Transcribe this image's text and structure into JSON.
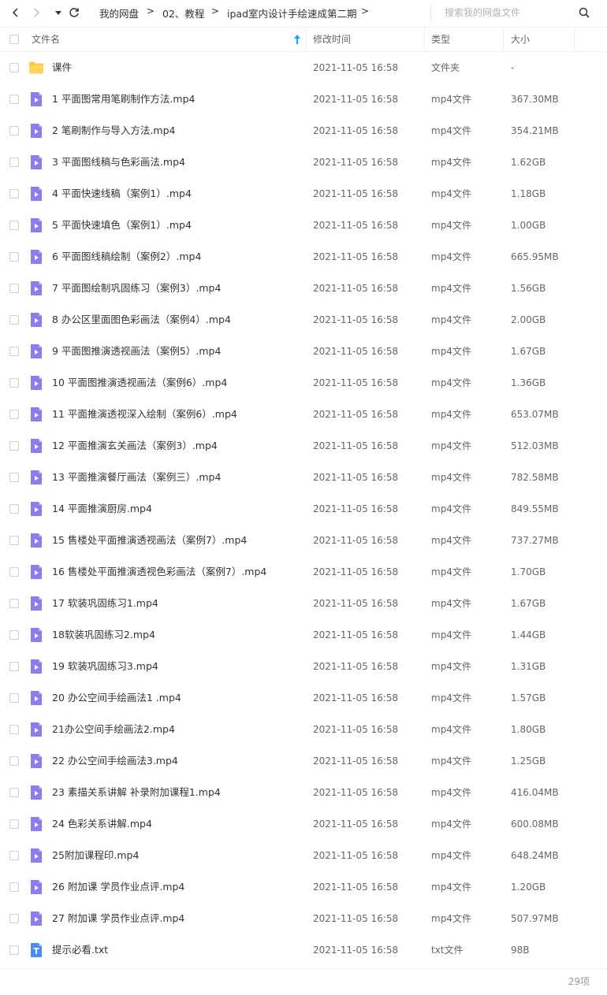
{
  "toolbar": {
    "breadcrumb": [
      {
        "label": "我的网盘"
      },
      {
        "label": "02、教程"
      },
      {
        "label": "ipad室内设计手绘速成第二期"
      }
    ],
    "breadcrumb_separator": ">",
    "search_placeholder": "搜索我的网盘文件"
  },
  "header": {
    "name": "文件名",
    "modified": "修改时间",
    "type": "类型",
    "size": "大小",
    "sort_direction": "ascending"
  },
  "files": [
    {
      "name": "课件",
      "time": "2021-11-05 16:58",
      "type": "文件夹",
      "size": "-",
      "icon": "folder-icon"
    },
    {
      "name": "1 平面图常用笔刷制作方法.mp4",
      "time": "2021-11-05 16:58",
      "type": "mp4文件",
      "size": "367.30MB",
      "icon": "video-file-icon"
    },
    {
      "name": "2 笔刷制作与导入方法.mp4",
      "time": "2021-11-05 16:58",
      "type": "mp4文件",
      "size": "354.21MB",
      "icon": "video-file-icon"
    },
    {
      "name": "3 平面图线稿与色彩画法.mp4",
      "time": "2021-11-05 16:58",
      "type": "mp4文件",
      "size": "1.62GB",
      "icon": "video-file-icon"
    },
    {
      "name": "4 平面快速线稿（案例1）.mp4",
      "time": "2021-11-05 16:58",
      "type": "mp4文件",
      "size": "1.18GB",
      "icon": "video-file-icon"
    },
    {
      "name": "5 平面快速填色（案例1）.mp4",
      "time": "2021-11-05 16:58",
      "type": "mp4文件",
      "size": "1.00GB",
      "icon": "video-file-icon"
    },
    {
      "name": "6 平面图线稿绘制（案例2）.mp4",
      "time": "2021-11-05 16:58",
      "type": "mp4文件",
      "size": "665.95MB",
      "icon": "video-file-icon"
    },
    {
      "name": "7 平面图绘制巩固练习（案例3）.mp4",
      "time": "2021-11-05 16:58",
      "type": "mp4文件",
      "size": "1.56GB",
      "icon": "video-file-icon"
    },
    {
      "name": "8  办公区里面图色彩画法（案例4）.mp4",
      "time": "2021-11-05 16:58",
      "type": "mp4文件",
      "size": "2.00GB",
      "icon": "video-file-icon"
    },
    {
      "name": "9 平面图推演透视画法（案例5）.mp4",
      "time": "2021-11-05 16:58",
      "type": "mp4文件",
      "size": "1.67GB",
      "icon": "video-file-icon"
    },
    {
      "name": "10  平面图推演透视画法（案例6）.mp4",
      "time": "2021-11-05 16:58",
      "type": "mp4文件",
      "size": "1.36GB",
      "icon": "video-file-icon"
    },
    {
      "name": "11 平面推演透视深入绘制（案例6）.mp4",
      "time": "2021-11-05 16:58",
      "type": "mp4文件",
      "size": "653.07MB",
      "icon": "video-file-icon"
    },
    {
      "name": "12 平面推演玄关画法（案例3）.mp4",
      "time": "2021-11-05 16:58",
      "type": "mp4文件",
      "size": "512.03MB",
      "icon": "video-file-icon"
    },
    {
      "name": "13  平面推演餐厅画法（案例三）.mp4",
      "time": "2021-11-05 16:58",
      "type": "mp4文件",
      "size": "782.58MB",
      "icon": "video-file-icon"
    },
    {
      "name": "14 平面推演厨房.mp4",
      "time": "2021-11-05 16:58",
      "type": "mp4文件",
      "size": "849.55MB",
      "icon": "video-file-icon"
    },
    {
      "name": "15 售楼处平面推演透视画法（案例7）.mp4",
      "time": "2021-11-05 16:58",
      "type": "mp4文件",
      "size": "737.27MB",
      "icon": "video-file-icon"
    },
    {
      "name": "16 售楼处平面推演透视色彩画法（案例7）.mp4",
      "time": "2021-11-05 16:58",
      "type": "mp4文件",
      "size": "1.70GB",
      "icon": "video-file-icon"
    },
    {
      "name": "17 软装巩固练习1.mp4",
      "time": "2021-11-05 16:58",
      "type": "mp4文件",
      "size": "1.67GB",
      "icon": "video-file-icon"
    },
    {
      "name": "18软装巩固练习2.mp4",
      "time": "2021-11-05 16:58",
      "type": "mp4文件",
      "size": "1.44GB",
      "icon": "video-file-icon"
    },
    {
      "name": "19 软装巩固练习3.mp4",
      "time": "2021-11-05 16:58",
      "type": "mp4文件",
      "size": "1.31GB",
      "icon": "video-file-icon"
    },
    {
      "name": "20 办公空间手绘画法1 .mp4",
      "time": "2021-11-05 16:58",
      "type": "mp4文件",
      "size": "1.57GB",
      "icon": "video-file-icon"
    },
    {
      "name": "21办公空间手绘画法2.mp4",
      "time": "2021-11-05 16:58",
      "type": "mp4文件",
      "size": "1.80GB",
      "icon": "video-file-icon"
    },
    {
      "name": "22  办公空间手绘画法3.mp4",
      "time": "2021-11-05 16:58",
      "type": "mp4文件",
      "size": "1.25GB",
      "icon": "video-file-icon"
    },
    {
      "name": "23 素描关系讲解 补录附加课程1.mp4",
      "time": "2021-11-05 16:58",
      "type": "mp4文件",
      "size": "416.04MB",
      "icon": "video-file-icon"
    },
    {
      "name": "24 色彩关系讲解.mp4",
      "time": "2021-11-05 16:58",
      "type": "mp4文件",
      "size": "600.08MB",
      "icon": "video-file-icon"
    },
    {
      "name": "25附加课程印.mp4",
      "time": "2021-11-05 16:58",
      "type": "mp4文件",
      "size": "648.24MB",
      "icon": "video-file-icon"
    },
    {
      "name": "26 附加课 学员作业点评.mp4",
      "time": "2021-11-05 16:58",
      "type": "mp4文件",
      "size": "1.20GB",
      "icon": "video-file-icon"
    },
    {
      "name": "27 附加课 学员作业点评.mp4",
      "time": "2021-11-05 16:58",
      "type": "mp4文件",
      "size": "507.97MB",
      "icon": "video-file-icon"
    },
    {
      "name": "提示必看.txt",
      "time": "2021-11-05 16:58",
      "type": "txt文件",
      "size": "98B",
      "icon": "text-file-icon"
    }
  ],
  "footer": {
    "count": "29项"
  },
  "colors": {
    "folder": "#FFC73A",
    "video": "#8C7CF0",
    "text_file": "#4B8DF8",
    "sort_arrow": "#06A7FF"
  }
}
